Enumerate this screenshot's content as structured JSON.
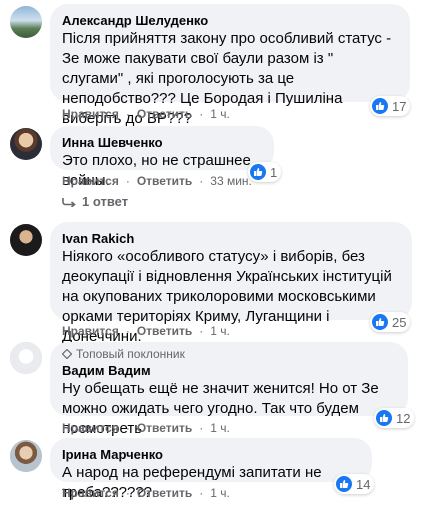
{
  "comments": [
    {
      "author": "Александр Шелуденко",
      "text": "Після прийняття закону про особливий статус - Зе може пакувати свої баули разом із \" слугами\" , які проголосують за це неподобство??? Це Бородая і Пушиліна виберіть до ВР???",
      "like_label": "Нравится",
      "reply_label": "Ответить",
      "time": "1 ч.",
      "reaction_count": "17"
    },
    {
      "author": "Инна Шевченко",
      "text": "Это плохо, но не страшнее войны.",
      "like_label": "Нравится",
      "reply_label": "Ответить",
      "time": "33 мин.",
      "reaction_count": "1",
      "replies_label": "1 ответ"
    },
    {
      "author": "Ivan Rakich",
      "text": "Ніякого «особливого статусу» і виборів, без деокупації і відновлення Українських інституцій на окупованих триколоровими московськими орками територіях Криму, Луганщини і Донеччини.",
      "like_label": "Нравится",
      "reply_label": "Ответить",
      "time": "1 ч.",
      "reaction_count": "25"
    },
    {
      "badge": "Топовый поклонник",
      "author": "Вадим Вадим",
      "text": "Ну обещать ещё не значит женится! Но от Зе можно ожидать чего угодно. Так что будем посмотреть",
      "like_label": "Нравится",
      "reply_label": "Ответить",
      "time": "1 ч.",
      "reaction_count": "12"
    },
    {
      "author": "Ірина Марченко",
      "text": "А народ на референдумі запитати не треба??????",
      "like_label": "Нравится",
      "reply_label": "Ответить",
      "time": "1 ч.",
      "reaction_count": "14"
    }
  ],
  "icons": {
    "like": "thumbs-up-icon",
    "reply_arrow": "reply-arrow-icon",
    "badge": "diamond-icon"
  },
  "colors": {
    "bubble": "#f0f2f5",
    "like_blue": "#1877f2",
    "secondary_text": "#65676b"
  }
}
